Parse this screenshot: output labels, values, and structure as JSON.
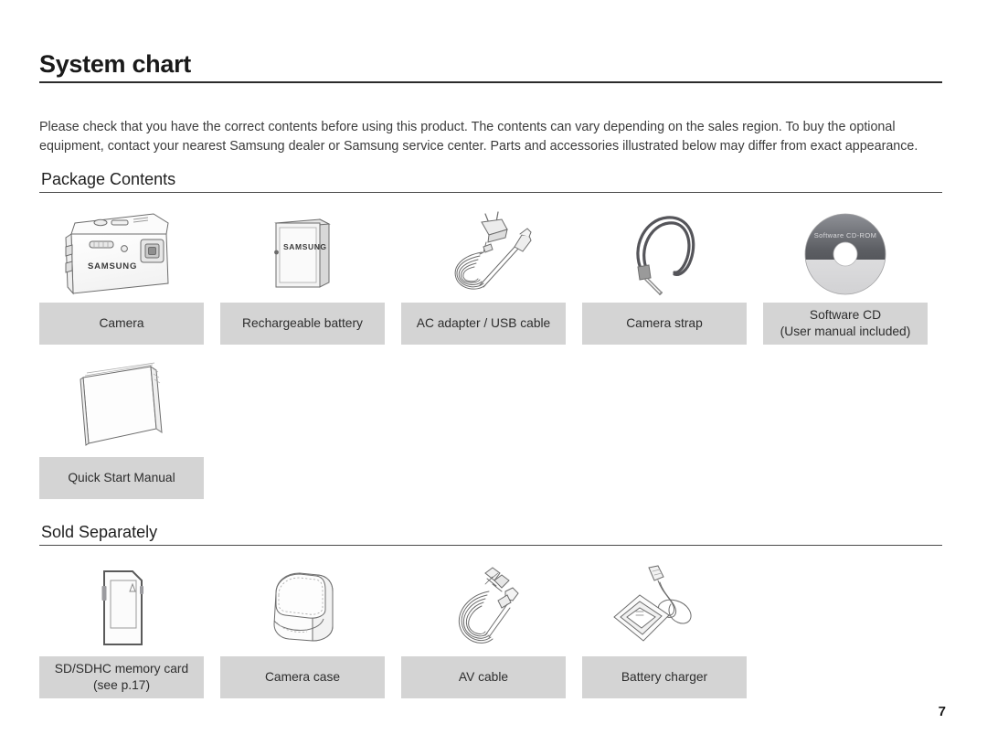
{
  "document": {
    "title": "System chart",
    "intro": "Please check that you have the correct contents before using this product. The contents can vary depending on the sales region. To buy the optional equipment, contact your nearest Samsung dealer or Samsung service center. Parts and accessories illustrated below may differ from exact appearance.",
    "page_number": "7"
  },
  "sections": [
    {
      "heading": "Package Contents",
      "items": [
        {
          "label": "Camera",
          "icon": "camera-icon",
          "brand": "SAMSUNG"
        },
        {
          "label": "Rechargeable battery",
          "icon": "battery-icon",
          "brand": "SAMSUNG"
        },
        {
          "label": "AC adapter / USB cable",
          "icon": "ac-adapter-usb-cable-icon"
        },
        {
          "label": "Camera strap",
          "icon": "camera-strap-icon"
        },
        {
          "label": "Software CD\n(User manual included)",
          "line1": "Software CD",
          "line2": "(User manual included)",
          "icon": "software-cd-icon",
          "disc_text": "Software CD-ROM"
        },
        {
          "label": "Quick Start Manual",
          "icon": "quick-start-manual-icon"
        }
      ]
    },
    {
      "heading": "Sold Separately",
      "items": [
        {
          "label": "SD/SDHC memory card\n(see p.17)",
          "line1": "SD/SDHC memory card",
          "line2": "(see p.17)",
          "icon": "sd-card-icon"
        },
        {
          "label": "Camera case",
          "icon": "camera-case-icon"
        },
        {
          "label": "AV cable",
          "icon": "av-cable-icon"
        },
        {
          "label": "Battery charger",
          "icon": "battery-charger-icon"
        }
      ]
    }
  ],
  "colors": {
    "caption_background": "#d4d4d4",
    "text": "#2d2d2d",
    "rule": "#4a4a4a",
    "title_rule": "#2b2b2b"
  }
}
